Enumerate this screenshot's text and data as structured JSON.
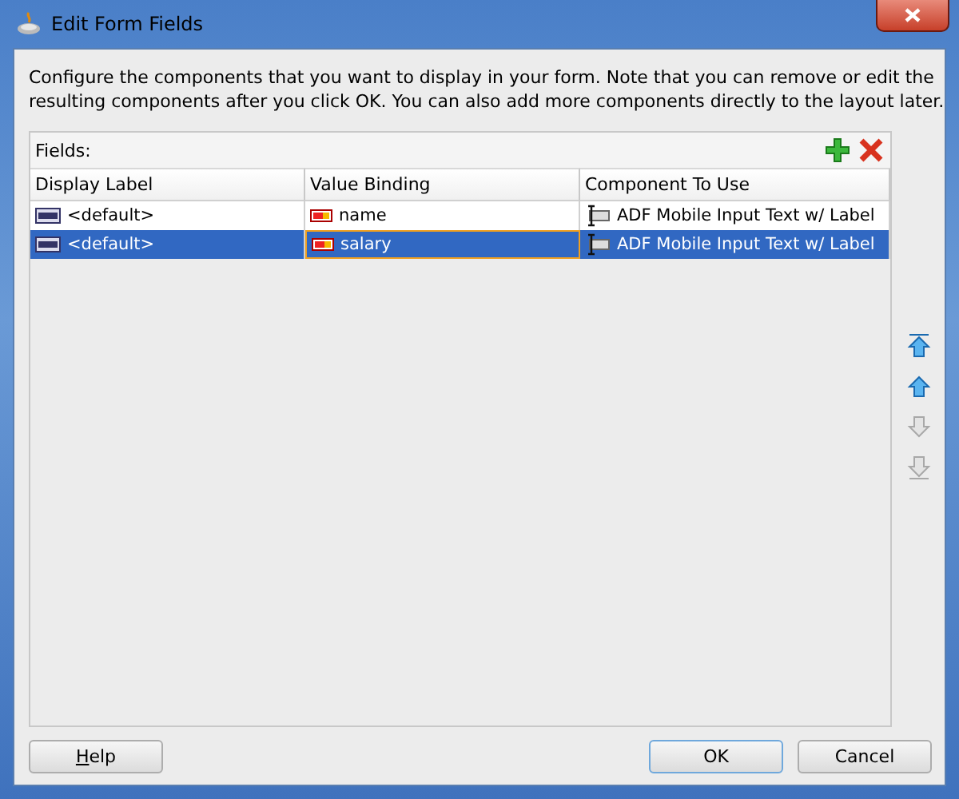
{
  "window": {
    "title": "Edit Form Fields"
  },
  "instructions": "Configure the components that you want to display in your form.  Note that you can remove or edit the resulting components after you click OK.  You can also add more components directly to the layout later.",
  "fields_label": "Fields:",
  "columns": [
    "Display Label",
    "Value Binding",
    "Component To Use"
  ],
  "rows": [
    {
      "label": "<default>",
      "binding": "name",
      "component": "ADF Mobile Input Text w/ Label",
      "selected": false
    },
    {
      "label": "<default>",
      "binding": "salary",
      "component": "ADF Mobile Input Text w/ Label",
      "selected": true
    }
  ],
  "move_buttons": [
    {
      "kind": "top",
      "disabled": false
    },
    {
      "kind": "up",
      "disabled": false
    },
    {
      "kind": "down",
      "disabled": true
    },
    {
      "kind": "bottom",
      "disabled": true
    }
  ],
  "buttons": {
    "help": "Help",
    "ok": "OK",
    "cancel": "Cancel"
  }
}
